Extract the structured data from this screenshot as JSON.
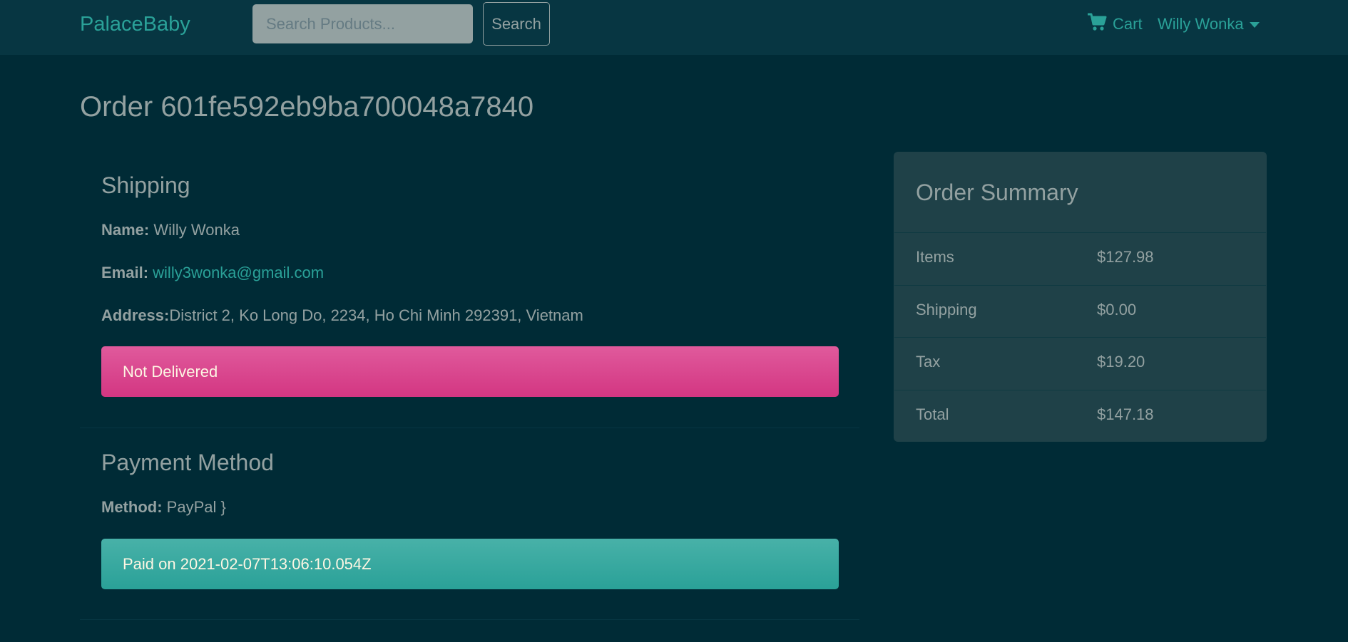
{
  "navbar": {
    "brand": "PalaceBaby",
    "search_placeholder": "Search Products...",
    "search_button": "Search",
    "cart_label": "Cart",
    "user_name": "Willy Wonka"
  },
  "order": {
    "title": "Order 601fe592eb9ba700048a7840"
  },
  "shipping": {
    "heading": "Shipping",
    "name_label": "Name:",
    "name_value": "Willy Wonka",
    "email_label": "Email:",
    "email_value": "willy3wonka@gmail.com",
    "address_label": "Address:",
    "address_value": "District 2, Ko Long Do, 2234, Ho Chi Minh 292391, Vietnam",
    "status": "Not Delivered"
  },
  "payment": {
    "heading": "Payment Method",
    "method_label": "Method:",
    "method_value": "PayPal",
    "status": "Paid on 2021-02-07T13:06:10.054Z"
  },
  "summary": {
    "title": "Order Summary",
    "rows": [
      {
        "label": "Items",
        "value": "$127.98"
      },
      {
        "label": "Shipping",
        "value": "$0.00"
      },
      {
        "label": "Tax",
        "value": "$19.20"
      },
      {
        "label": "Total",
        "value": "$147.18"
      }
    ]
  },
  "colors": {
    "background": "#002b36",
    "navbar": "#073642",
    "accent": "#2aa198",
    "danger": "#d33682",
    "text": "#93a1a1",
    "card": "#1f4148"
  }
}
